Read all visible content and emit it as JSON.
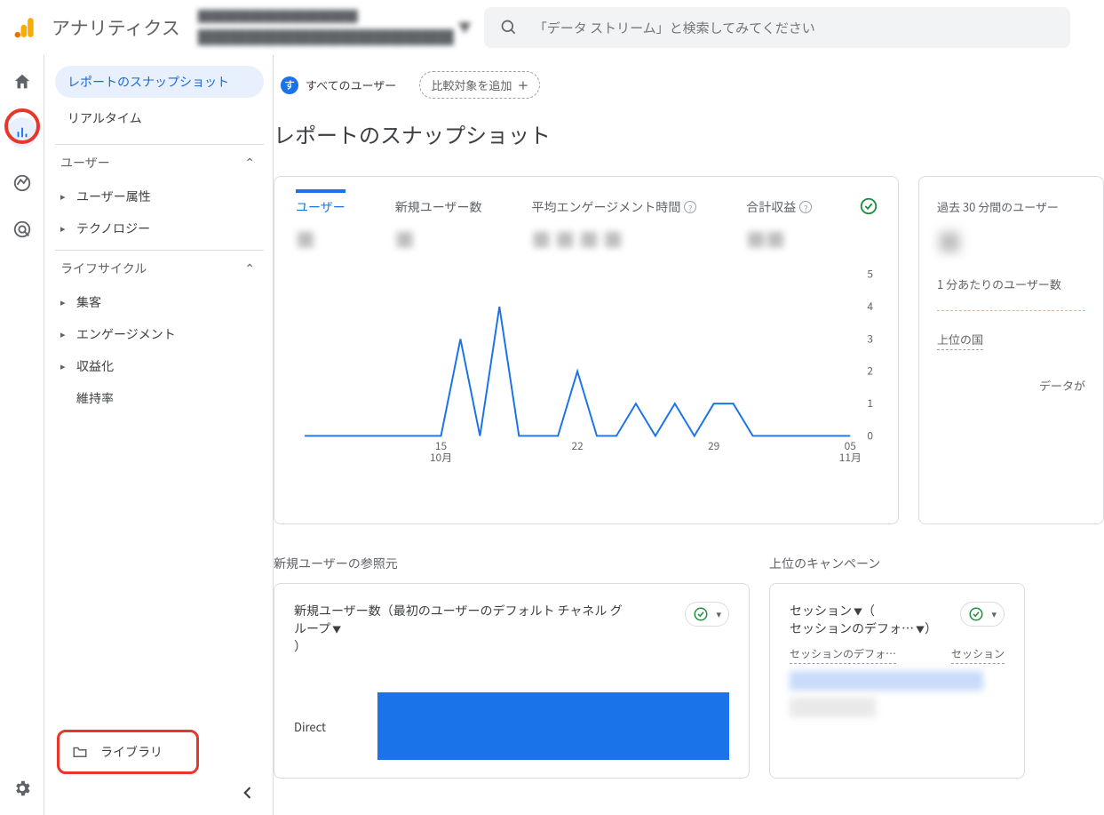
{
  "topbar": {
    "app_title": "アナリティクス",
    "property_line1": "████████████",
    "property_line2": "████████████████",
    "search_placeholder": "「データ ストリーム」と検索してみてください"
  },
  "sidebar": {
    "snapshot": "レポートのスナップショット",
    "realtime": "リアルタイム",
    "section_user": "ユーザー",
    "user_attr": "ユーザー属性",
    "technology": "テクノロジー",
    "section_lifecycle": "ライフサイクル",
    "acquisition": "集客",
    "engagement": "エンゲージメント",
    "monetization": "収益化",
    "retention": "維持率",
    "library": "ライブラリ"
  },
  "main": {
    "chip_all_badge": "す",
    "chip_all": "すべてのユーザー",
    "chip_add": "比較対象を追加",
    "page_title": "レポートのスナップショット"
  },
  "metrics": {
    "users": "ユーザー",
    "new_users": "新規ユーザー数",
    "avg_engagement": "平均エンゲージメント時間",
    "total_revenue": "合計収益",
    "v_users": "■",
    "v_new_users": "■",
    "v_avg": "■ ■ ■ ■",
    "v_rev": "■■"
  },
  "realtime": {
    "past30": "過去 30 分間のユーザー",
    "value": "■",
    "per_minute": "1 分あたりのユーザー数",
    "top_countries": "上位の国",
    "nodata": "データが"
  },
  "row2": {
    "referrers_title": "新規ユーザーの参照元",
    "campaigns_title": "上位のキャンペーン",
    "ref_header": "新規ユーザー数（最初のユーザーのデフォルト チャネル グループ",
    "ref_header_close": "）",
    "bar_label": "Direct",
    "camp_header_1": "セッション",
    "camp_header_open": "（",
    "camp_header_2": "セッションのデフォ…",
    "camp_header_close": "）",
    "th_left": "セッションのデフォ…",
    "th_right": "セッション"
  },
  "chart_data": {
    "type": "line",
    "title": "",
    "xlabel": "",
    "ylabel": "",
    "ylim": [
      0,
      5
    ],
    "y_ticks": [
      0,
      1,
      2,
      3,
      4,
      5
    ],
    "x_tick_labels": [
      "15",
      "22",
      "29",
      "05"
    ],
    "x_tick_sublabels": [
      "10月",
      "",
      "",
      "11月"
    ],
    "values": [
      0,
      0,
      0,
      0,
      0,
      0,
      0,
      0,
      3,
      0,
      4,
      0,
      0,
      0,
      2,
      0,
      0,
      1,
      0,
      1,
      0,
      1,
      1,
      0,
      0,
      0,
      0,
      0,
      0
    ]
  }
}
